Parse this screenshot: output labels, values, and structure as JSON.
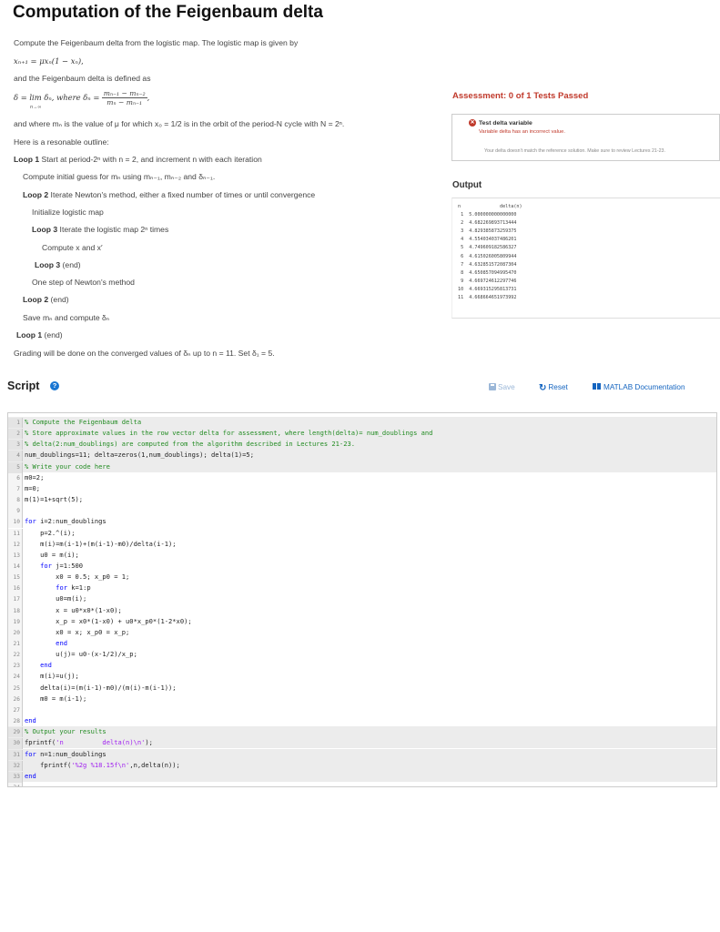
{
  "title": "Computation of the Feigenbaum delta",
  "description": {
    "intro": "Compute the Feigenbaum delta from the logistic map.  The logistic map is given by",
    "logistic_eq": "x",
    "logistic_eq_full": "xₙ₊₁ = μxₙ(1 − xₙ),",
    "delta_intro": "and the Feigenbaum delta is defined as",
    "delta_lhs": "δ = lim δₙ, where δₙ =",
    "delta_lim_sub": "n→∞",
    "delta_num": "mₙ₋₁ − mₙ₋₂",
    "delta_den": "mₙ − mₙ₋₁",
    "where_text": "and where mₙ is the value of μ for which x₀ = 1/2 is in the orbit of the period-N cycle with N = 2ⁿ.",
    "outline_intro": "Here is a resonable outline:",
    "outline": [
      {
        "bold": "Loop 1",
        "text": " Start at period-2ⁿ with n = 2,  and increment n with each iteration"
      },
      {
        "bold": "",
        "text": "Compute initial guess for mₙ using mₙ₋₁, mₙ₋₂ and δₙ₋₁."
      },
      {
        "bold": "Loop 2",
        "text": " Iterate Newton's method, either a fixed number of times or until convergence"
      },
      {
        "bold": "",
        "text": "Initialize logistic map"
      },
      {
        "bold": "Loop 3",
        "text": " Iterate the logistic map 2ⁿ times"
      },
      {
        "bold": "",
        "text": "Compute x and x′"
      },
      {
        "bold": "Loop 3",
        "text": " (end)"
      },
      {
        "bold": "",
        "text": "One step of Newton's method"
      },
      {
        "bold": "Loop 2",
        "text": " (end)"
      },
      {
        "bold": "",
        "text": "Save mₙ and compute δₙ"
      },
      {
        "bold": "Loop 1",
        "text": " (end)"
      }
    ],
    "grading": "Grading will be done on the converged values of δₙ up to n = 11. Set δ₁ = 5."
  },
  "assessment": {
    "title": "Assessment: 0 of 1 Tests Passed",
    "test_name": "Test delta variable",
    "test_msg": "Variable delta has an incorrect value.",
    "test_detail": "Your delta doesn't match the reference solution.  Make sure to review Lectures 21-23."
  },
  "output": {
    "title": "Output",
    "header": "n              delta(n)",
    "rows": [
      " 1  5.000000000000000",
      " 2  4.682269893713444",
      " 3  4.829385873259375",
      " 4  4.554034037486201",
      " 5  4.749609182586327",
      " 6  4.615026005809944",
      " 7  4.632851572087304",
      " 8  4.650857094995470",
      " 9  4.669724612297746",
      "10  4.669315295813731",
      "11  4.668664651973992"
    ]
  },
  "script": {
    "title": "Script",
    "save_label": "Save",
    "reset_label": "Reset",
    "doc_label": "MATLAB Documentation",
    "lines": [
      "% Compute the Feigenbaum delta",
      "% Store approximate values in the row vector delta for assessment, where length(delta)= num_doublings and",
      "% delta(2:num_doublings) are computed from the algorithm described in Lectures 21-23.",
      "num_doublings=11; delta=zeros(1,num_doublings); delta(1)=5;",
      "% Write your code here",
      "m0=2;",
      "m=0;",
      "m(1)=1+sqrt(5);",
      "",
      "for i=2:num_doublings",
      "    p=2.^(i);",
      "    m(i)=m(i-1)+(m(i-1)-m0)/delta(i-1);",
      "    u0 = m(i);",
      "    for j=1:500",
      "        x0 = 0.5; x_p0 = 1;",
      "        for k=1:p",
      "        u0=m(i);",
      "        x = u0*x0*(1-x0);",
      "        x_p = x0*(1-x0) + u0*x_p0*(1-2*x0);",
      "        x0 = x; x_p0 = x_p;",
      "        end",
      "        u(j)= u0-(x-1/2)/x_p;",
      "    end",
      "    m(i)=u(j);",
      "    delta(i)=(m(i-1)-m0)/(m(i)-m(i-1));",
      "    m0 = m(i-1);",
      "",
      "end",
      "% Output your results",
      "fprintf('n          delta(n)\\n');",
      "for n=1:num_doublings",
      "    fprintf('%2g %18.15f\\n',n,delta(n));",
      "end",
      ""
    ],
    "locked_lines": [
      1,
      2,
      3,
      4,
      5,
      29,
      30,
      31,
      32,
      33
    ]
  }
}
